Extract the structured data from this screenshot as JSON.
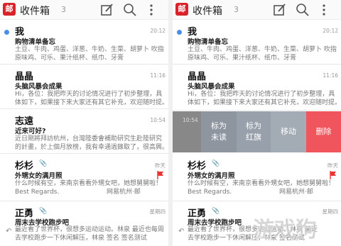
{
  "app": {
    "logo_text": "邮",
    "inbox_title": "收件箱",
    "inbox_count": "3",
    "accent_color": "#d9222a"
  },
  "mails": [
    {
      "sender": "我",
      "subject": "购物清单备忘",
      "preview_line1": "土豆、牛肉、鸡蛋、洋葱、牛奶、生菜、胡萝卜 吹指",
      "preview_line2": "原味鸡、可乐、果汁纸杯、纸巾、牙膏",
      "time": "20:12",
      "unread": true
    },
    {
      "sender": "晶晶",
      "subject": "头脑风暴会成果",
      "preview_line1": "Hi，各位：我把昨天的讨论情况进行了初步整理，具",
      "preview_line2": "体如下，如果接下来大家还有其它补充，欢迎随时提。",
      "time": "11:16",
      "unread": false
    },
    {
      "sender": "志遠",
      "subject": "近来可好?",
      "preview_line1": "近日剛將拜訪杭州，台灣陸委會補助研究生赴陸研究",
      "preview_line2": "的計畫，於上個月放榜，我有幸通過錄取了，很高興。",
      "time": "10:54",
      "unread": false
    },
    {
      "sender": "杉杉",
      "subject": "外甥女的满月照",
      "preview_line1": "什么时候有空，来南京看看外甥女吧，她想舅舅啦！",
      "preview_line2": "Best Regards.",
      "preview_line3": "网易杭州·邮",
      "time": "昨天",
      "has_attachment": true,
      "flagged": true
    },
    {
      "sender": "正勇",
      "subject": "周末去学校跑步吧",
      "preview_line1": "最近看了世界杯，很想多运动运动。林泉 最近也每周",
      "preview_line2": "去学校跑步一下休闲解压，林泉 签名 签名测试",
      "time": "星期四",
      "has_attachment": true,
      "replied": true
    }
  ],
  "swipe_actions": {
    "time": "10:54",
    "mark_unread": [
      "标为",
      "未读"
    ],
    "mark_red_flag": [
      "标为",
      "红旗"
    ],
    "move": "移动",
    "delete": "删除",
    "delete_color": "#f0545c"
  },
  "right_mails_partial": {
    "shanshan_preview_line1": "什么时候有空，来南京看看外甥女吧，她想舅舅啦！",
    "shanshan_preview_line2": "Best Regards.",
    "shanshan_preview_line3": "网易杭州·邮",
    "zhengyong_preview_line1": "最近看了世界杯，很想多运动运动。林泉 最近",
    "zhengyong_preview_line2": "去学校跑步一下休闲解压，林泉 签名测试"
  },
  "watermark": {
    "text": "游戏狗"
  }
}
